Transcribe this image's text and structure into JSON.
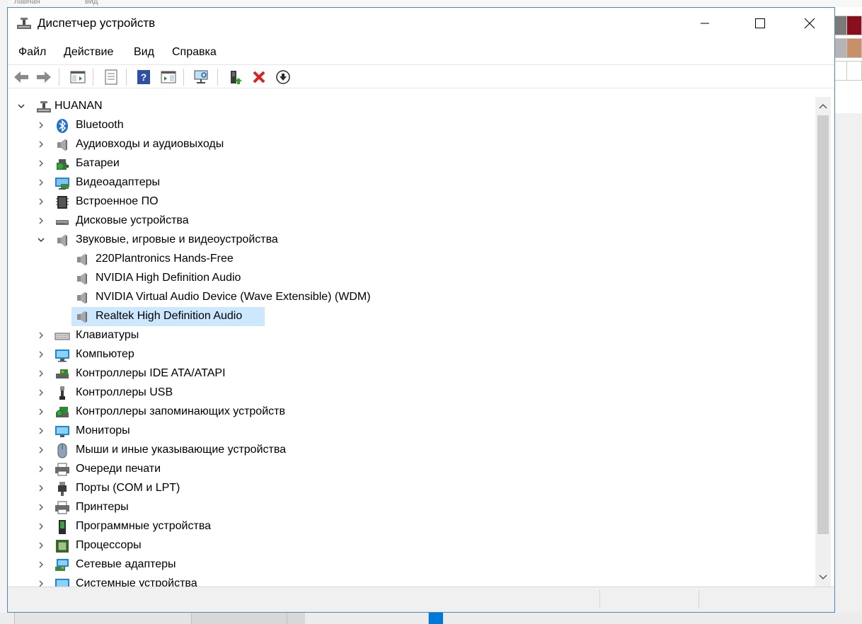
{
  "window": {
    "title": "Диспетчер устройств",
    "controls": [
      "minimize",
      "maximize",
      "close"
    ]
  },
  "menu": [
    "Файл",
    "Действие",
    "Вид",
    "Справка"
  ],
  "toolbar": [
    "back-icon",
    "forward-icon",
    "show-hide-console-tree-icon",
    "properties-icon",
    "help-icon",
    "action-pane-icon",
    "scan-hardware-icon",
    "update-driver-icon",
    "uninstall-icon",
    "disable-icon"
  ],
  "tree": {
    "root": "HUANAN",
    "items": [
      {
        "label": "Bluetooth",
        "icon": "bluetooth-icon",
        "expanded": false
      },
      {
        "label": "Аудиовходы и аудиовыходы",
        "icon": "speaker-icon",
        "expanded": false
      },
      {
        "label": "Батареи",
        "icon": "battery-icon",
        "expanded": false
      },
      {
        "label": "Видеоадаптеры",
        "icon": "display-adapter-icon",
        "expanded": false
      },
      {
        "label": "Встроенное ПО",
        "icon": "firmware-icon",
        "expanded": false
      },
      {
        "label": "Дисковые устройства",
        "icon": "disk-icon",
        "expanded": false
      },
      {
        "label": "Звуковые, игровые и видеоустройства",
        "icon": "speaker-icon",
        "expanded": true,
        "children": [
          {
            "label": "220Plantronics Hands-Free",
            "icon": "speaker-icon"
          },
          {
            "label": "NVIDIA High Definition Audio",
            "icon": "speaker-icon"
          },
          {
            "label": "NVIDIA Virtual Audio Device (Wave Extensible) (WDM)",
            "icon": "speaker-icon"
          },
          {
            "label": "Realtek High Definition Audio",
            "icon": "speaker-icon",
            "selected": true
          }
        ]
      },
      {
        "label": "Клавиатуры",
        "icon": "keyboard-icon",
        "expanded": false
      },
      {
        "label": "Компьютер",
        "icon": "computer-icon",
        "expanded": false
      },
      {
        "label": "Контроллеры IDE ATA/ATAPI",
        "icon": "ide-controller-icon",
        "expanded": false
      },
      {
        "label": "Контроллеры USB",
        "icon": "usb-icon",
        "expanded": false
      },
      {
        "label": "Контроллеры запоминающих устройств",
        "icon": "storage-controller-icon",
        "expanded": false
      },
      {
        "label": "Мониторы",
        "icon": "monitor-icon",
        "expanded": false
      },
      {
        "label": "Мыши и иные указывающие устройства",
        "icon": "mouse-icon",
        "expanded": false
      },
      {
        "label": "Очереди печати",
        "icon": "print-queue-icon",
        "expanded": false
      },
      {
        "label": "Порты (COM и LPT)",
        "icon": "port-icon",
        "expanded": false
      },
      {
        "label": "Принтеры",
        "icon": "printer-icon",
        "expanded": false
      },
      {
        "label": "Программные устройства",
        "icon": "software-device-icon",
        "expanded": false
      },
      {
        "label": "Процессоры",
        "icon": "processor-icon",
        "expanded": false
      },
      {
        "label": "Сетевые адаптеры",
        "icon": "network-adapter-icon",
        "expanded": false
      },
      {
        "label": "Системные устройства",
        "icon": "system-device-icon",
        "expanded": false
      }
    ]
  },
  "colors": {
    "selection": "#cce8ff",
    "window_border": "#4a86c8",
    "accent_blue": "#0078d7"
  }
}
